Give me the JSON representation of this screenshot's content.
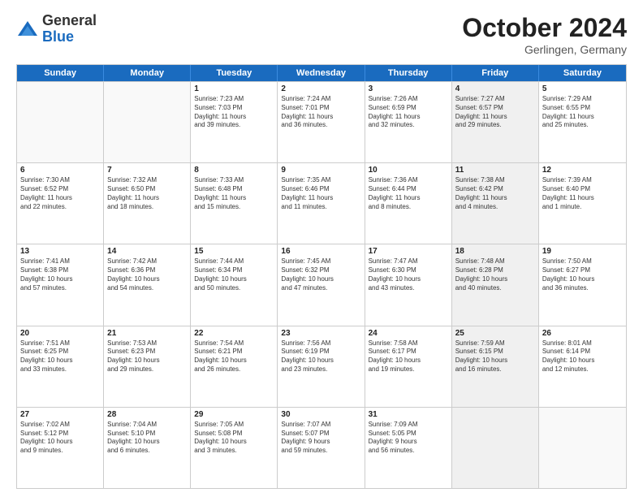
{
  "header": {
    "logo_general": "General",
    "logo_blue": "Blue",
    "month_title": "October 2024",
    "location": "Gerlingen, Germany"
  },
  "weekdays": [
    "Sunday",
    "Monday",
    "Tuesday",
    "Wednesday",
    "Thursday",
    "Friday",
    "Saturday"
  ],
  "rows": [
    [
      {
        "day": "",
        "lines": [],
        "empty": true
      },
      {
        "day": "",
        "lines": [],
        "empty": true
      },
      {
        "day": "1",
        "lines": [
          "Sunrise: 7:23 AM",
          "Sunset: 7:03 PM",
          "Daylight: 11 hours",
          "and 39 minutes."
        ]
      },
      {
        "day": "2",
        "lines": [
          "Sunrise: 7:24 AM",
          "Sunset: 7:01 PM",
          "Daylight: 11 hours",
          "and 36 minutes."
        ]
      },
      {
        "day": "3",
        "lines": [
          "Sunrise: 7:26 AM",
          "Sunset: 6:59 PM",
          "Daylight: 11 hours",
          "and 32 minutes."
        ]
      },
      {
        "day": "4",
        "lines": [
          "Sunrise: 7:27 AM",
          "Sunset: 6:57 PM",
          "Daylight: 11 hours",
          "and 29 minutes."
        ]
      },
      {
        "day": "5",
        "lines": [
          "Sunrise: 7:29 AM",
          "Sunset: 6:55 PM",
          "Daylight: 11 hours",
          "and 25 minutes."
        ]
      }
    ],
    [
      {
        "day": "6",
        "lines": [
          "Sunrise: 7:30 AM",
          "Sunset: 6:52 PM",
          "Daylight: 11 hours",
          "and 22 minutes."
        ]
      },
      {
        "day": "7",
        "lines": [
          "Sunrise: 7:32 AM",
          "Sunset: 6:50 PM",
          "Daylight: 11 hours",
          "and 18 minutes."
        ]
      },
      {
        "day": "8",
        "lines": [
          "Sunrise: 7:33 AM",
          "Sunset: 6:48 PM",
          "Daylight: 11 hours",
          "and 15 minutes."
        ]
      },
      {
        "day": "9",
        "lines": [
          "Sunrise: 7:35 AM",
          "Sunset: 6:46 PM",
          "Daylight: 11 hours",
          "and 11 minutes."
        ]
      },
      {
        "day": "10",
        "lines": [
          "Sunrise: 7:36 AM",
          "Sunset: 6:44 PM",
          "Daylight: 11 hours",
          "and 8 minutes."
        ]
      },
      {
        "day": "11",
        "lines": [
          "Sunrise: 7:38 AM",
          "Sunset: 6:42 PM",
          "Daylight: 11 hours",
          "and 4 minutes."
        ]
      },
      {
        "day": "12",
        "lines": [
          "Sunrise: 7:39 AM",
          "Sunset: 6:40 PM",
          "Daylight: 11 hours",
          "and 1 minute."
        ]
      }
    ],
    [
      {
        "day": "13",
        "lines": [
          "Sunrise: 7:41 AM",
          "Sunset: 6:38 PM",
          "Daylight: 10 hours",
          "and 57 minutes."
        ]
      },
      {
        "day": "14",
        "lines": [
          "Sunrise: 7:42 AM",
          "Sunset: 6:36 PM",
          "Daylight: 10 hours",
          "and 54 minutes."
        ]
      },
      {
        "day": "15",
        "lines": [
          "Sunrise: 7:44 AM",
          "Sunset: 6:34 PM",
          "Daylight: 10 hours",
          "and 50 minutes."
        ]
      },
      {
        "day": "16",
        "lines": [
          "Sunrise: 7:45 AM",
          "Sunset: 6:32 PM",
          "Daylight: 10 hours",
          "and 47 minutes."
        ]
      },
      {
        "day": "17",
        "lines": [
          "Sunrise: 7:47 AM",
          "Sunset: 6:30 PM",
          "Daylight: 10 hours",
          "and 43 minutes."
        ]
      },
      {
        "day": "18",
        "lines": [
          "Sunrise: 7:48 AM",
          "Sunset: 6:28 PM",
          "Daylight: 10 hours",
          "and 40 minutes."
        ]
      },
      {
        "day": "19",
        "lines": [
          "Sunrise: 7:50 AM",
          "Sunset: 6:27 PM",
          "Daylight: 10 hours",
          "and 36 minutes."
        ]
      }
    ],
    [
      {
        "day": "20",
        "lines": [
          "Sunrise: 7:51 AM",
          "Sunset: 6:25 PM",
          "Daylight: 10 hours",
          "and 33 minutes."
        ]
      },
      {
        "day": "21",
        "lines": [
          "Sunrise: 7:53 AM",
          "Sunset: 6:23 PM",
          "Daylight: 10 hours",
          "and 29 minutes."
        ]
      },
      {
        "day": "22",
        "lines": [
          "Sunrise: 7:54 AM",
          "Sunset: 6:21 PM",
          "Daylight: 10 hours",
          "and 26 minutes."
        ]
      },
      {
        "day": "23",
        "lines": [
          "Sunrise: 7:56 AM",
          "Sunset: 6:19 PM",
          "Daylight: 10 hours",
          "and 23 minutes."
        ]
      },
      {
        "day": "24",
        "lines": [
          "Sunrise: 7:58 AM",
          "Sunset: 6:17 PM",
          "Daylight: 10 hours",
          "and 19 minutes."
        ]
      },
      {
        "day": "25",
        "lines": [
          "Sunrise: 7:59 AM",
          "Sunset: 6:15 PM",
          "Daylight: 10 hours",
          "and 16 minutes."
        ]
      },
      {
        "day": "26",
        "lines": [
          "Sunrise: 8:01 AM",
          "Sunset: 6:14 PM",
          "Daylight: 10 hours",
          "and 12 minutes."
        ]
      }
    ],
    [
      {
        "day": "27",
        "lines": [
          "Sunrise: 7:02 AM",
          "Sunset: 5:12 PM",
          "Daylight: 10 hours",
          "and 9 minutes."
        ]
      },
      {
        "day": "28",
        "lines": [
          "Sunrise: 7:04 AM",
          "Sunset: 5:10 PM",
          "Daylight: 10 hours",
          "and 6 minutes."
        ]
      },
      {
        "day": "29",
        "lines": [
          "Sunrise: 7:05 AM",
          "Sunset: 5:08 PM",
          "Daylight: 10 hours",
          "and 3 minutes."
        ]
      },
      {
        "day": "30",
        "lines": [
          "Sunrise: 7:07 AM",
          "Sunset: 5:07 PM",
          "Daylight: 9 hours",
          "and 59 minutes."
        ]
      },
      {
        "day": "31",
        "lines": [
          "Sunrise: 7:09 AM",
          "Sunset: 5:05 PM",
          "Daylight: 9 hours",
          "and 56 minutes."
        ]
      },
      {
        "day": "",
        "lines": [],
        "empty": true
      },
      {
        "day": "",
        "lines": [],
        "empty": true
      }
    ]
  ]
}
